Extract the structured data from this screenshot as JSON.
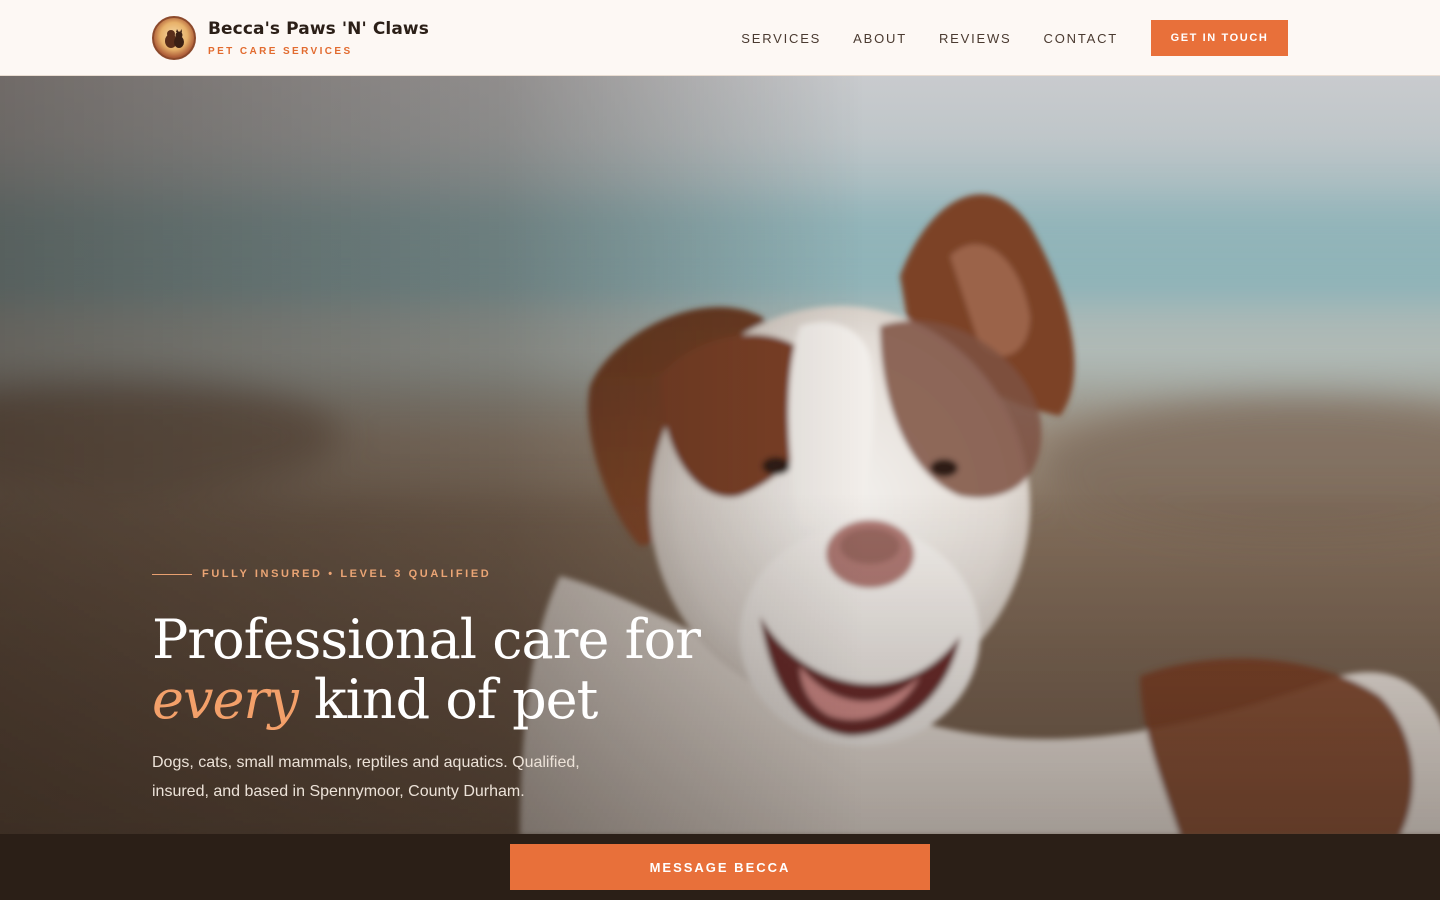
{
  "header": {
    "brand_name": "Becca's Paws 'N' Claws",
    "brand_tagline": "PET CARE SERVICES",
    "logo_icon": "paw-logo-icon",
    "nav": [
      {
        "label": "SERVICES"
      },
      {
        "label": "ABOUT"
      },
      {
        "label": "REVIEWS"
      },
      {
        "label": "CONTACT"
      }
    ],
    "cta_label": "GET IN TOUCH"
  },
  "hero": {
    "eyebrow": "FULLY INSURED • LEVEL 3 QUALIFIED",
    "title_line1": "Professional care for",
    "title_accent": "every",
    "title_line2_rest": " kind of pet",
    "subtitle": "Dogs, cats, small mammals, reptiles and aquatics. Qualified, insured, and based in Spennymoor, County Durham."
  },
  "footer_bar": {
    "message_label": "MESSAGE BECCA"
  },
  "colors": {
    "accent": "#e8703a",
    "header_bg": "#fdf8f4",
    "dark": "#2b1f17",
    "accent_light": "#f3a06a"
  }
}
